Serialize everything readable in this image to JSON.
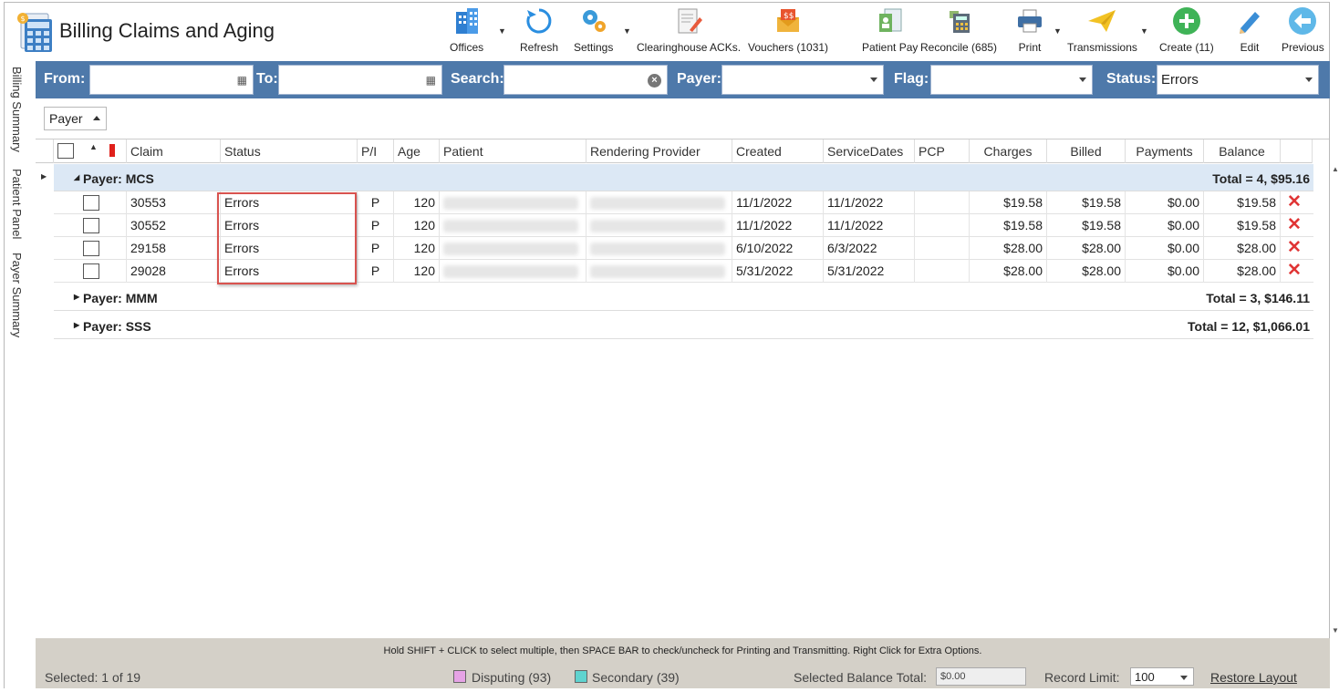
{
  "app": {
    "title": "Billing Claims and Aging"
  },
  "toolbar": [
    {
      "name": "offices",
      "label": "Offices",
      "icon": "building-icon"
    },
    {
      "name": "refresh",
      "label": "Refresh",
      "icon": "refresh-icon"
    },
    {
      "name": "settings",
      "label": "Settings",
      "icon": "gears-icon"
    },
    {
      "name": "clearinghouse",
      "label": "Clearinghouse ACKs.",
      "icon": "document-pen-icon"
    },
    {
      "name": "vouchers",
      "label": "Vouchers (1031)",
      "icon": "money-envelope-icon"
    },
    {
      "name": "patient-pay",
      "label": "Patient Pay",
      "icon": "patient-document-icon"
    },
    {
      "name": "reconcile",
      "label": "Reconcile (685)",
      "icon": "calculator-icon"
    },
    {
      "name": "print",
      "label": "Print",
      "icon": "printer-icon"
    },
    {
      "name": "transmissions",
      "label": "Transmissions",
      "icon": "paper-plane-icon"
    },
    {
      "name": "create",
      "label": "Create (11)",
      "icon": "plus-circle-icon"
    },
    {
      "name": "edit",
      "label": "Edit",
      "icon": "pencil-icon"
    },
    {
      "name": "previous",
      "label": "Previous",
      "icon": "back-arrow-icon"
    }
  ],
  "side_tabs": [
    "Billing Summary",
    "Patient Panel",
    "Payer Summary"
  ],
  "filters": {
    "from_label": "From:",
    "from_value": "",
    "to_label": "To:",
    "to_value": "",
    "search_label": "Search:",
    "search_value": "",
    "payer_label": "Payer:",
    "payer_value": "",
    "flag_label": "Flag:",
    "flag_value": "",
    "status_label": "Status:",
    "status_value": "Errors"
  },
  "group_by": "Payer",
  "columns": [
    "Claim",
    "Status",
    "P/I",
    "Age",
    "Patient",
    "Rendering Provider",
    "Created",
    "ServiceDates",
    "PCP",
    "Charges",
    "Billed",
    "Payments",
    "Balance"
  ],
  "groups": [
    {
      "label": "Payer: MCS",
      "total": "Total = 4,  $95.16",
      "expanded": true,
      "rows": [
        {
          "claim": "30553",
          "status": "Errors",
          "pi": "P",
          "age": "120",
          "created": "11/1/2022",
          "service": "11/1/2022",
          "pcp": "",
          "charges": "$19.58",
          "billed": "$19.58",
          "payments": "$0.00",
          "balance": "$19.58"
        },
        {
          "claim": "30552",
          "status": "Errors",
          "pi": "P",
          "age": "120",
          "created": "11/1/2022",
          "service": "11/1/2022",
          "pcp": "",
          "charges": "$19.58",
          "billed": "$19.58",
          "payments": "$0.00",
          "balance": "$19.58"
        },
        {
          "claim": "29158",
          "status": "Errors",
          "pi": "P",
          "age": "120",
          "created": "6/10/2022",
          "service": "6/3/2022",
          "pcp": "",
          "charges": "$28.00",
          "billed": "$28.00",
          "payments": "$0.00",
          "balance": "$28.00"
        },
        {
          "claim": "29028",
          "status": "Errors",
          "pi": "P",
          "age": "120",
          "created": "5/31/2022",
          "service": "5/31/2022",
          "pcp": "",
          "charges": "$28.00",
          "billed": "$28.00",
          "payments": "$0.00",
          "balance": "$28.00"
        }
      ]
    },
    {
      "label": "Payer: MMM",
      "total": "Total = 3,  $146.11",
      "expanded": false,
      "rows": []
    },
    {
      "label": "Payer: SSS",
      "total": "Total = 12,  $1,066.01",
      "expanded": false,
      "rows": []
    }
  ],
  "footer": {
    "hint": "Hold SHIFT + CLICK to select multiple, then SPACE BAR to check/uncheck for Printing and Transmitting. Right Click for Extra Options.",
    "selected": "Selected: 1 of 19",
    "disputing": "Disputing (93)",
    "disputing_color": "#e6a3e6",
    "secondary": "Secondary (39)",
    "secondary_color": "#5fd3cf",
    "selected_balance_label": "Selected Balance Total:",
    "selected_balance_value": "$0.00",
    "record_limit_label": "Record Limit:",
    "record_limit_value": "100",
    "restore_layout": "Restore Layout"
  }
}
